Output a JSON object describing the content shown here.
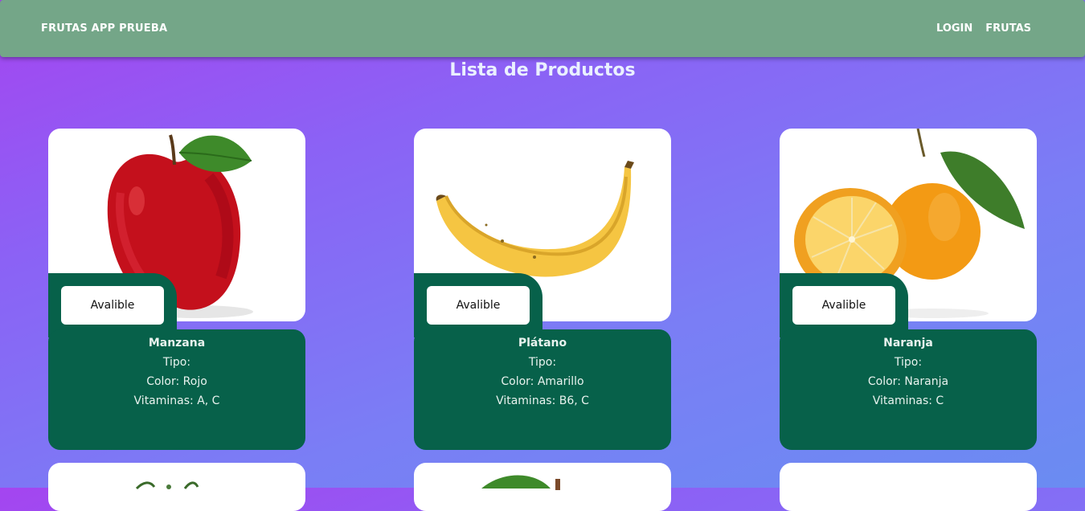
{
  "nav": {
    "brand": "FRUTAS APP PRUEBA",
    "links": [
      "LOGIN",
      "FRUTAS"
    ]
  },
  "page_title": "Lista de Productos",
  "products": [
    {
      "name": "Manzana",
      "status": "Avalible",
      "tipo": "Tipo:",
      "color": "Color: Rojo",
      "vitaminas": "Vitaminas: A, C",
      "image": "apple-image"
    },
    {
      "name": "Plátano",
      "status": "Avalible",
      "tipo": "Tipo:",
      "color": "Color: Amarillo",
      "vitaminas": "Vitaminas: B6, C",
      "image": "banana-image"
    },
    {
      "name": "Naranja",
      "status": "Avalible",
      "tipo": "Tipo:",
      "color": "Color: Naranja",
      "vitaminas": "Vitaminas: C",
      "image": "orange-image"
    }
  ],
  "colors": {
    "navbar": "#74a688",
    "card_panel": "#07614a",
    "background_start": "#a445f0",
    "background_end": "#6a8cf2"
  }
}
